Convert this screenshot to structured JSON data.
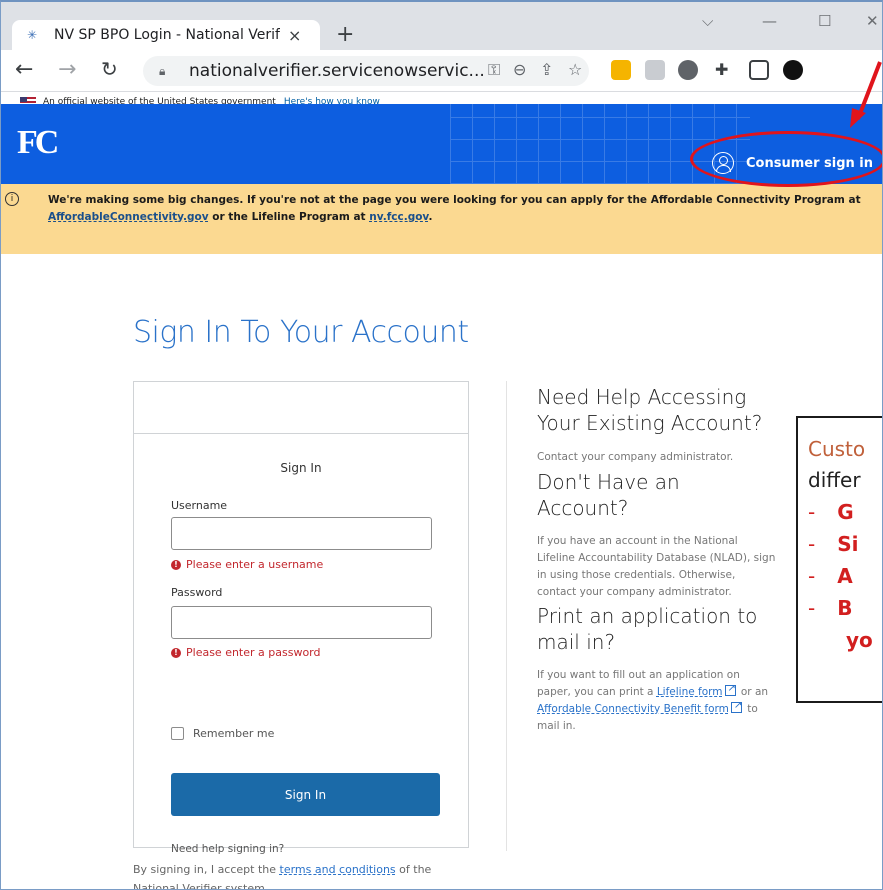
{
  "browser": {
    "tab_title": "NV SP BPO Login - National Verif",
    "tab_close": "×",
    "new_tab": "+",
    "url": "nationalverifier.servicenowservic...",
    "win_chevron": "⌵",
    "win_min": "—",
    "win_max": "☐",
    "win_close": "✕"
  },
  "gov_banner": {
    "text": "An official website of the United States government",
    "link": "Here's how you know"
  },
  "header": {
    "logo": "FC",
    "consumer_signin": "Consumer sign in"
  },
  "alert": {
    "line1": "We're making some big changes. If you're not at the page you were looking for you can apply for the Affordable Connectivity Program at",
    "link1": "AffordableConnectivity.gov",
    "mid": " or the Lifeline Program at ",
    "link2": "nv.fcc.gov",
    "end": "."
  },
  "page_title": "Sign In To Your Account",
  "form": {
    "heading": "Sign In",
    "username_label": "Username",
    "username_error": "Please enter a username",
    "password_label": "Password",
    "password_error": "Please enter a password",
    "remember_label": "Remember me",
    "signin_button": "Sign In",
    "help_link": "Need help signing in?"
  },
  "accept": {
    "pre": "By signing in, I accept the ",
    "link": "terms and conditions",
    "post": " of the National Verifier system."
  },
  "help": {
    "h1": "Need Help Accessing Your Existing Account?",
    "p1": "Contact your company administrator.",
    "h2": "Don't Have an Account?",
    "p2": "If you have an account in the National Lifeline Accountability Database (NLAD), sign in using those credentials. Otherwise, contact your company administrator.",
    "h3": "Print an application to mail in?",
    "p3_pre": "If you want to fill out an application on paper, you can print a ",
    "p3_link1": "Lifeline form",
    "p3_mid": " or an ",
    "p3_link2": "Affordable Connectivity Benefit form",
    "p3_post": " to mail in."
  },
  "callout": {
    "line1": "Custo",
    "line2": "differ",
    "items": [
      "G",
      "Si",
      "A",
      "B"
    ],
    "item4_cont": "yo"
  },
  "colors": {
    "fcc_blue": "#0d5ee0",
    "alert_bg": "#fbd991",
    "button_blue": "#1b6aa8",
    "error_red": "#c2272d",
    "annotation_red": "#e0141c"
  }
}
